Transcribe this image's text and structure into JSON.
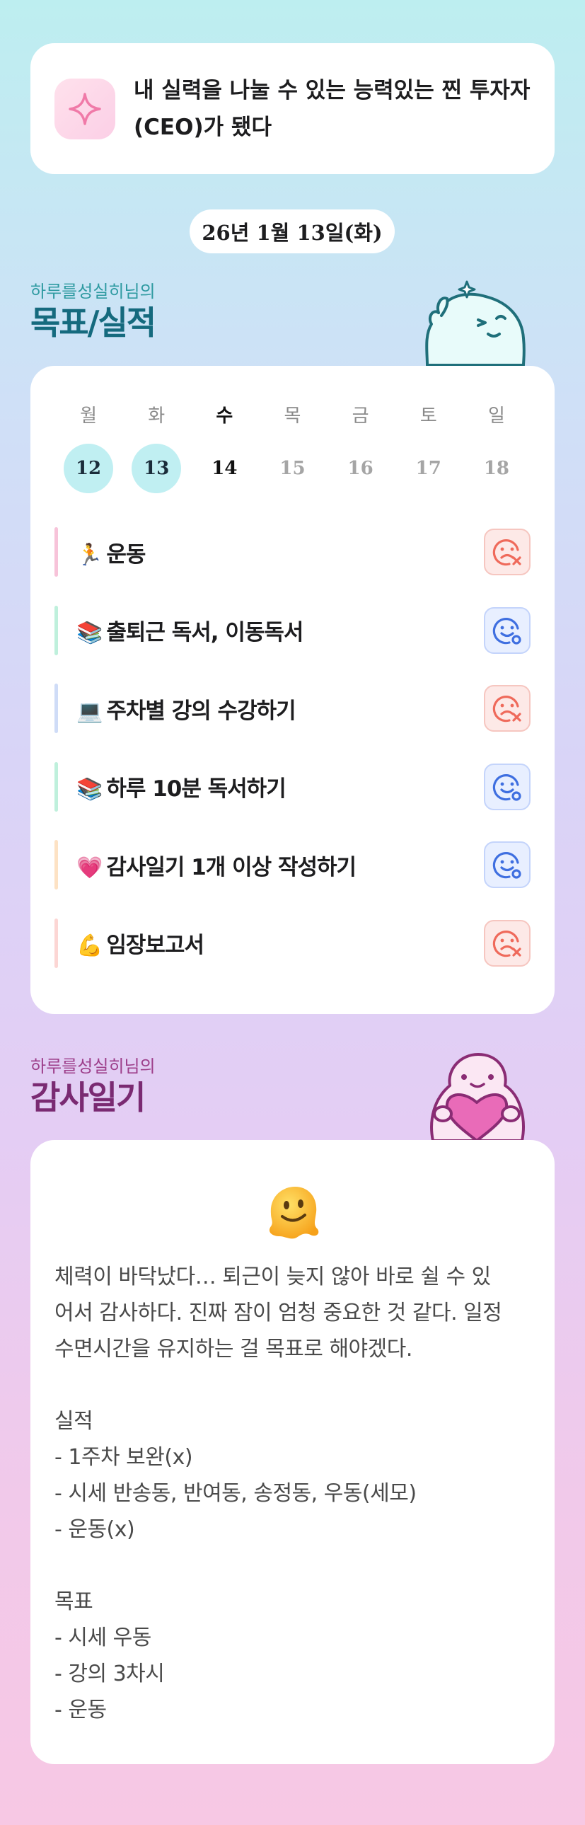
{
  "goal": {
    "line1": "내 실력을 나눌 수 있는 능력있는 찐 투자자",
    "line2": "(CEO)가 됐다"
  },
  "date": "26년 1월 13일(화)",
  "goals_section": {
    "subtitle": "하루를성실히님의",
    "title": "목표/실적"
  },
  "week": {
    "days": [
      "월",
      "화",
      "수",
      "목",
      "금",
      "토",
      "일"
    ],
    "dates": [
      "12",
      "13",
      "14",
      "15",
      "16",
      "17",
      "18"
    ],
    "done": [
      true,
      true,
      false,
      false,
      false,
      false,
      false
    ],
    "today_index": 2
  },
  "tasks": [
    {
      "emoji": "🏃",
      "label": "운동",
      "status": "fail",
      "bar_color": "#f7c3d9"
    },
    {
      "emoji": "📚",
      "label": "출퇴근 독서, 이동독서",
      "status": "ok",
      "bar_color": "#bff0dc"
    },
    {
      "emoji": "💻",
      "label": "주차별 강의 수강하기",
      "status": "fail",
      "bar_color": "#cfdcf7"
    },
    {
      "emoji": "📚",
      "label": "하루 10분 독서하기",
      "status": "ok",
      "bar_color": "#bff0dc"
    },
    {
      "emoji": "💗",
      "label": "감사일기 1개 이상 작성하기",
      "status": "ok",
      "bar_color": "#fde2c4"
    },
    {
      "emoji": "💪",
      "label": "임장보고서",
      "status": "fail",
      "bar_color": "#fcd6d4"
    }
  ],
  "gratitude_section": {
    "subtitle": "하루를성실히님의",
    "title": "감사일기",
    "emoji": "melting-face-icon",
    "lines": [
      "체력이 바닥났다… 퇴근이 늦지 않아 바로 쉴 수 있",
      "어서 감사하다. 진짜 잠이 엄청 중요한 것 같다. 일정",
      "수면시간을 유지하는 걸 목표로 해야겠다.",
      "",
      "실적",
      "- 1주차 보완(x)",
      "- 시세 반송동, 반여동, 송정동, 우동(세모)",
      "- 운동(x)",
      "",
      "목표",
      "- 시세 우동",
      "- 강의 3차시",
      "- 운동"
    ]
  },
  "colors": {
    "fail": "#ef6a5b",
    "ok": "#3f6fe0",
    "accent_teal": "#156a7e",
    "accent_plum": "#7a2a72"
  }
}
